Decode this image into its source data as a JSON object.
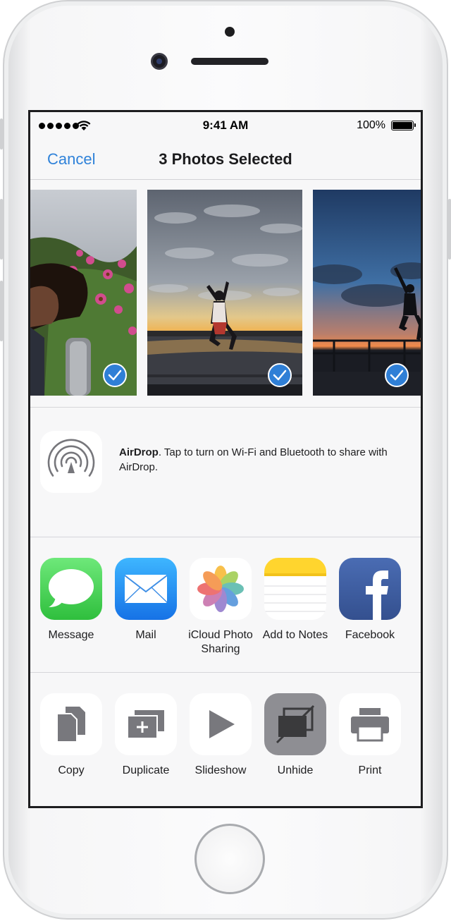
{
  "status_bar": {
    "time": "9:41 AM",
    "battery_percent": "100%",
    "signal_dots": 5
  },
  "nav": {
    "cancel_label": "Cancel",
    "title": "3 Photos Selected"
  },
  "photos": [
    {
      "subject": "woman among pink flowers",
      "selected": true
    },
    {
      "subject": "person jumping at sunset by water",
      "selected": true
    },
    {
      "subject": "person jumping at dusk on pier",
      "selected": true
    }
  ],
  "airdrop": {
    "title": "AirDrop",
    "message": ". Tap to turn on Wi-Fi and Bluetooth to share with AirDrop."
  },
  "share_apps": [
    {
      "label": "Message",
      "icon": "message-icon"
    },
    {
      "label": "Mail",
      "icon": "mail-icon"
    },
    {
      "label": "iCloud Photo Sharing",
      "icon": "photos-icon"
    },
    {
      "label": "Add to Notes",
      "icon": "notes-icon"
    },
    {
      "label": "Facebook",
      "icon": "facebook-icon"
    }
  ],
  "actions": [
    {
      "label": "Copy",
      "icon": "copy-icon"
    },
    {
      "label": "Duplicate",
      "icon": "duplicate-icon"
    },
    {
      "label": "Slideshow",
      "icon": "play-icon"
    },
    {
      "label": "Unhide",
      "icon": "unhide-icon"
    },
    {
      "label": "Print",
      "icon": "printer-icon"
    }
  ],
  "colors": {
    "accent": "#2f82d9",
    "checkmark": "#2f7fd6",
    "messages_green": "#4cd964",
    "mail_blue": "#1e8ff0",
    "facebook_blue": "#3b5998",
    "notes_yellow": "#ffd52e",
    "unhide_tile": "#8e8e93"
  }
}
